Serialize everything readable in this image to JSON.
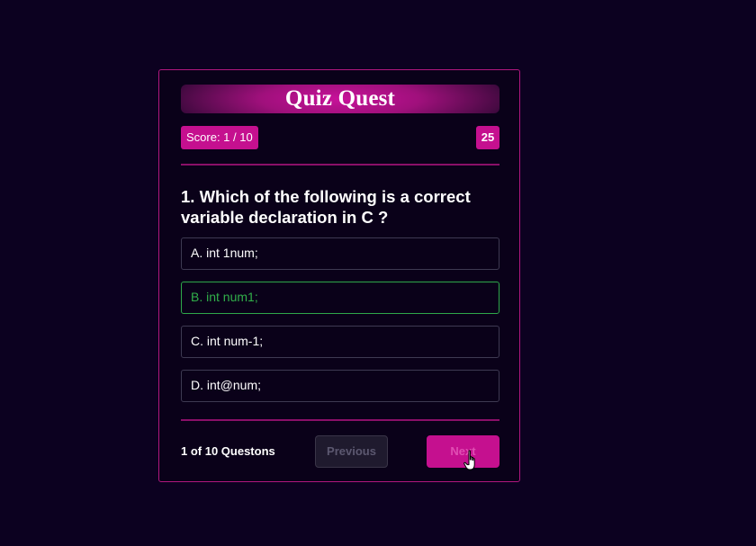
{
  "quiz": {
    "title": "Quiz Quest",
    "score_label": "Score: 1 / 10",
    "timer": "25",
    "question": "1. Which of the following is a correct variable declaration in C ?",
    "options": [
      {
        "label": "A. int 1num;",
        "state": "default"
      },
      {
        "label": "B. int num1;",
        "state": "correct"
      },
      {
        "label": "C. int num-1;",
        "state": "default"
      },
      {
        "label": "D. int@num;",
        "state": "default"
      }
    ],
    "progress": "1 of 10 Questons",
    "previous_label": "Previous",
    "next_label": "Next"
  },
  "colors": {
    "background": "#0c0120",
    "accent": "#c5108f",
    "correct": "#31b04a"
  },
  "icons": {
    "cursor": "hand-pointer-cursor-icon"
  }
}
